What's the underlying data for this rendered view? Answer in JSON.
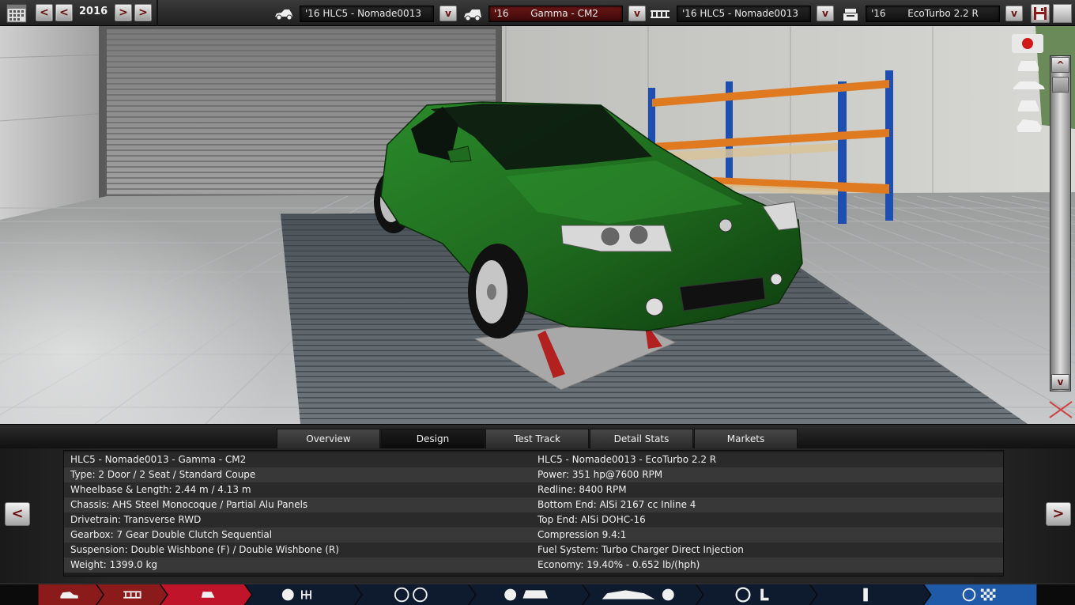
{
  "topbar": {
    "year": "2016",
    "model_select": "'16 HLC5 - Nomade0013",
    "trim_select_year": "'16",
    "trim_select_name": "Gamma - CM2",
    "variant_select": "'16 HLC5 - Nomade0013",
    "engine_select_year": "'16",
    "engine_select_name": "EcoTurbo 2.2 R",
    "prev_label": "<",
    "next_label": ">",
    "dropdown_label": "v"
  },
  "scrollbar": {
    "up_label": "^",
    "down_label": "v"
  },
  "tabs": [
    {
      "label": "Overview"
    },
    {
      "label": "Design"
    },
    {
      "label": "Test Track"
    },
    {
      "label": "Detail Stats"
    },
    {
      "label": "Markets"
    }
  ],
  "side_nav": {
    "prev_label": "<",
    "next_label": ">"
  },
  "info": {
    "left": [
      "HLC5 - Nomade0013 - Gamma - CM2",
      "Type: 2 Door / 2 Seat / Standard Coupe",
      "Wheelbase & Length: 2.44 m / 4.13 m",
      "Chassis: AHS Steel Monocoque / Partial Alu Panels",
      "Drivetrain: Transverse RWD",
      "Gearbox: 7 Gear Double Clutch Sequential",
      "Suspension: Double Wishbone (F) / Double Wishbone (R)",
      "Weight: 1399.0 kg"
    ],
    "right": [
      "HLC5 - Nomade0013 - EcoTurbo 2.2 R",
      "Power: 351 hp@7600 RPM",
      "Redline: 8400 RPM",
      "Bottom End: AlSi 2167 cc Inline 4",
      "Top End: AlSi DOHC-16",
      "Compression 9.4:1",
      "Fuel System: Turbo Charger Direct Injection",
      "Economy: 19.40% - 0.652 lb/(hph)"
    ]
  },
  "colors": {
    "accent_red": "#8b1a1a",
    "active_blue": "#1f5aa8",
    "car_green": "#1f6b1f"
  }
}
